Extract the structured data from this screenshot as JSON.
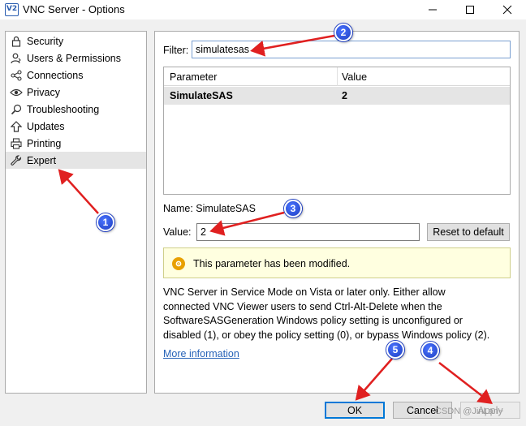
{
  "window": {
    "app_icon_text": "V2",
    "title": "VNC Server - Options"
  },
  "sidebar": {
    "items": [
      {
        "label": "Security",
        "icon": "lock-icon"
      },
      {
        "label": "Users & Permissions",
        "icon": "user-icon"
      },
      {
        "label": "Connections",
        "icon": "connections-icon"
      },
      {
        "label": "Privacy",
        "icon": "eye-icon"
      },
      {
        "label": "Troubleshooting",
        "icon": "magnifier-icon"
      },
      {
        "label": "Updates",
        "icon": "arrow-up-icon"
      },
      {
        "label": "Printing",
        "icon": "printer-icon"
      },
      {
        "label": "Expert",
        "icon": "wrench-icon",
        "selected": true
      }
    ]
  },
  "filter": {
    "label": "Filter:",
    "value": "simulatesas"
  },
  "table": {
    "columns": [
      "Parameter",
      "Value"
    ],
    "rows": [
      {
        "parameter": "SimulateSAS",
        "value": "2"
      }
    ]
  },
  "details": {
    "name_line": "Name: SimulateSAS",
    "value_label": "Value:",
    "value": "2",
    "reset_label": "Reset to default"
  },
  "notice": {
    "icon": "gear-warning-icon",
    "text": "This parameter has been modified."
  },
  "description": {
    "lines": [
      "VNC Server in Service Mode on Vista or later only. Either allow",
      "connected VNC Viewer users to send Ctrl-Alt-Delete when the",
      "SoftwareSASGeneration Windows policy setting is unconfigured or",
      "disabled (1), or obey the policy setting (0), or bypass Windows policy (2)."
    ]
  },
  "more_info_label": "More information",
  "buttons": {
    "ok": "OK",
    "cancel": "Cancel",
    "apply": "Apply"
  },
  "annotations": {
    "badges": [
      "1",
      "2",
      "3",
      "4",
      "5"
    ],
    "arrow_color": "#e02020",
    "badge_color": "#2448d8"
  },
  "watermark": "CSDN @JinLan~"
}
